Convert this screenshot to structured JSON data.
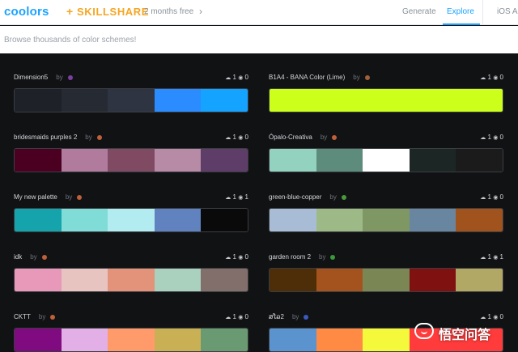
{
  "header": {
    "logo": "coolors",
    "plus": "+",
    "partner": "SKILLSHARE",
    "promo": "2 months free",
    "promo_chevron": "›",
    "nav": [
      {
        "label": "Generate",
        "active": false
      },
      {
        "label": "Explore",
        "active": true
      },
      {
        "label": "iOS A",
        "active": false
      }
    ]
  },
  "subheader": {
    "text": "Browse thousands of color schemes!"
  },
  "palettes": [
    {
      "name": "Dimension5",
      "by": "by",
      "avatar": "#7b3fa0",
      "likes": "1",
      "views": "0",
      "colors": [
        "#1e2128",
        "#262a33",
        "#2f3442",
        "#2a8cff",
        "#14a3ff"
      ]
    },
    {
      "name": "B1A4 - BANA Color (Lime)",
      "by": "by",
      "avatar": "#a0603a",
      "likes": "1",
      "views": "0",
      "colors": [
        "#ccff1a",
        "#ccff1a",
        "#ccff1a",
        "#ccff1a",
        "#ccff1a"
      ]
    },
    {
      "name": "bridesmaids purples 2",
      "by": "by",
      "avatar": "#c0603a",
      "likes": "1",
      "views": "0",
      "colors": [
        "#4b0022",
        "#b07b9d",
        "#804a63",
        "#b78aa6",
        "#5e3d69"
      ]
    },
    {
      "name": "Ópalo-Creativa",
      "by": "by",
      "avatar": "#c0603a",
      "likes": "1",
      "views": "0",
      "colors": [
        "#94d2c0",
        "#5e8c7c",
        "#ffffff",
        "#1c2624",
        "#1b1b1b"
      ]
    },
    {
      "name": "My new palette",
      "by": "by",
      "avatar": "#c0603a",
      "likes": "1",
      "views": "1",
      "colors": [
        "#16a4ac",
        "#7fdcd6",
        "#b3ecf0",
        "#6083c0",
        "#0a0a0a"
      ]
    },
    {
      "name": "green-blue-copper",
      "by": "by",
      "avatar": "#4a9a3a",
      "likes": "1",
      "views": "0",
      "colors": [
        "#a8bdd5",
        "#9dba86",
        "#7f9863",
        "#6986a0",
        "#a1531e"
      ]
    },
    {
      "name": "idk",
      "by": "by",
      "avatar": "#c0603a",
      "likes": "1",
      "views": "0",
      "colors": [
        "#e898b9",
        "#e8c4c0",
        "#e2937a",
        "#a9d1bd",
        "#826e6a"
      ]
    },
    {
      "name": "garden room 2",
      "by": "by",
      "avatar": "#3a9a3a",
      "likes": "1",
      "views": "1",
      "colors": [
        "#4d2e09",
        "#a4531e",
        "#7a8755",
        "#7f1111",
        "#b2a866"
      ]
    },
    {
      "name": "CKTT",
      "by": "by",
      "avatar": "#c0603a",
      "likes": "1",
      "views": "0",
      "colors": [
        "#800a80",
        "#e2b0e6",
        "#ff9a6a",
        "#c9b054",
        "#6a9a72"
      ]
    },
    {
      "name": "ສໂລ2",
      "by": "by",
      "avatar": "#3a5ac0",
      "likes": "1",
      "views": "0",
      "colors": [
        "#5b93cf",
        "#ff8a44",
        "#f5f93c",
        "#ff3b3b",
        "#ff3b3b"
      ]
    }
  ],
  "watermark": {
    "text": "悟空问答"
  }
}
